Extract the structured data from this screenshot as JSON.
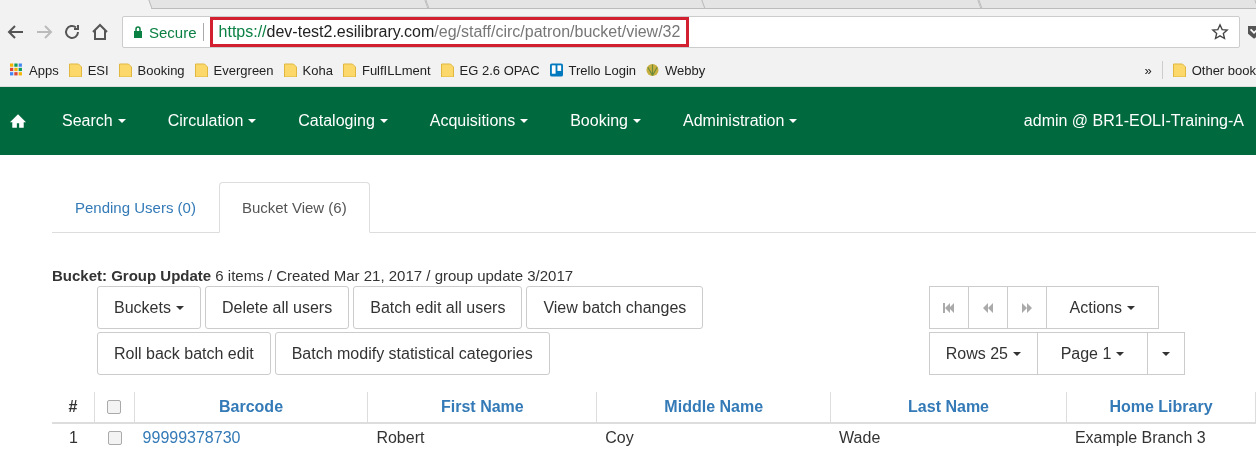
{
  "browser": {
    "secure_label": "Secure",
    "url_parts": [
      {
        "kind": "scheme",
        "text": "https://"
      },
      {
        "kind": "host",
        "text": "dev-test2.esilibrary.com"
      },
      {
        "kind": "path",
        "text": "/eg/staff/circ/patron/bucket/view/32"
      }
    ],
    "url_highlighted": true,
    "bookmarks": [
      {
        "kind": "apps",
        "label": "Apps"
      },
      {
        "kind": "folder",
        "label": "ESI"
      },
      {
        "kind": "folder",
        "label": "Booking"
      },
      {
        "kind": "folder",
        "label": "Evergreen"
      },
      {
        "kind": "folder",
        "label": "Koha"
      },
      {
        "kind": "folder",
        "label": "FulfILLment"
      },
      {
        "kind": "folder",
        "label": "EG 2.6 OPAC"
      },
      {
        "kind": "trello",
        "label": "Trello Login"
      },
      {
        "kind": "web",
        "label": "Webby"
      }
    ],
    "overflow": "»",
    "other_bookmarks": "Other book"
  },
  "navbar": {
    "items": [
      {
        "label": "Search"
      },
      {
        "label": "Circulation"
      },
      {
        "label": "Cataloging"
      },
      {
        "label": "Acquisitions"
      },
      {
        "label": "Booking"
      },
      {
        "label": "Administration"
      }
    ],
    "user": "admin @ BR1-EOLI-Training-A"
  },
  "tabs": [
    {
      "label": "Pending Users (0)",
      "selected": false
    },
    {
      "label": "Bucket View (6)",
      "selected": true
    }
  ],
  "bucket_summary": "**Bucket: Group Update** 6 items / Created Mar 21, 2017 / group update 3/2017",
  "button_rows": [
    [
      {
        "label": "Buckets",
        "dropdown": true
      },
      {
        "label": "Delete all users",
        "dropdown": false
      },
      {
        "label": "Batch edit all users",
        "dropdown": false
      },
      {
        "label": "View batch changes",
        "dropdown": false
      }
    ],
    [
      {
        "label": "Roll back batch edit",
        "dropdown": false
      },
      {
        "label": "Batch modify statistical categories",
        "dropdown": false
      }
    ]
  ],
  "pager": {
    "actions": "Actions",
    "rows": "Rows 25",
    "page": "Page 1"
  },
  "table": {
    "all_checked": false,
    "columns": [
      "#",
      "Barcode",
      "First Name",
      "Middle Name",
      "Last Name",
      "Home Library"
    ],
    "rows": [
      {
        "index": "1",
        "checked": false,
        "barcode": "99999378730",
        "first": "Robert",
        "middle": "Coy",
        "last": "Wade",
        "library": "Example Branch 3"
      }
    ]
  }
}
